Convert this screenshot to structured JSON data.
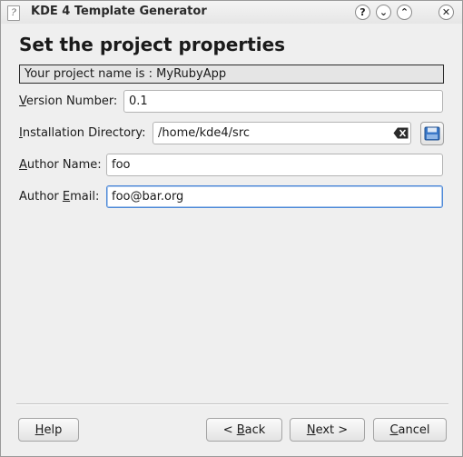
{
  "window": {
    "title": "KDE 4 Template Generator",
    "app_icon_glyph": "?",
    "controls": [
      {
        "name": "help",
        "glyph": "?"
      },
      {
        "name": "minimize",
        "glyph": "⌄"
      },
      {
        "name": "maximize",
        "glyph": "⌃"
      },
      {
        "name": "close",
        "glyph": "✕"
      }
    ]
  },
  "page": {
    "title": "Set the project properties",
    "project_banner": "Your project name is : MyRubyApp"
  },
  "form": {
    "version": {
      "label_mn": "V",
      "label_rest": "ersion Number:",
      "value": "0.1"
    },
    "install_dir": {
      "label_mn": "I",
      "label_rest": "nstallation Directory:",
      "value": "/home/kde4/src",
      "clear_icon": "clear-text-icon",
      "browse_icon": "folder-icon"
    },
    "author_name": {
      "label_pre": "",
      "label_mn": "A",
      "label_rest": "uthor Name:",
      "value": "foo"
    },
    "author_email": {
      "label_pre": "Author ",
      "label_mn": "E",
      "label_rest": "mail:",
      "value": "foo@bar.org"
    }
  },
  "buttons": {
    "help": {
      "mn": "H",
      "rest": "elp"
    },
    "back": {
      "pre": "< ",
      "mn": "B",
      "rest": "ack"
    },
    "next": {
      "mn": "N",
      "rest": "ext >"
    },
    "cancel": {
      "mn": "C",
      "rest": "ancel"
    }
  },
  "colors": {
    "focus_border": "#4f8ad8",
    "window_bg": "#efefef"
  }
}
